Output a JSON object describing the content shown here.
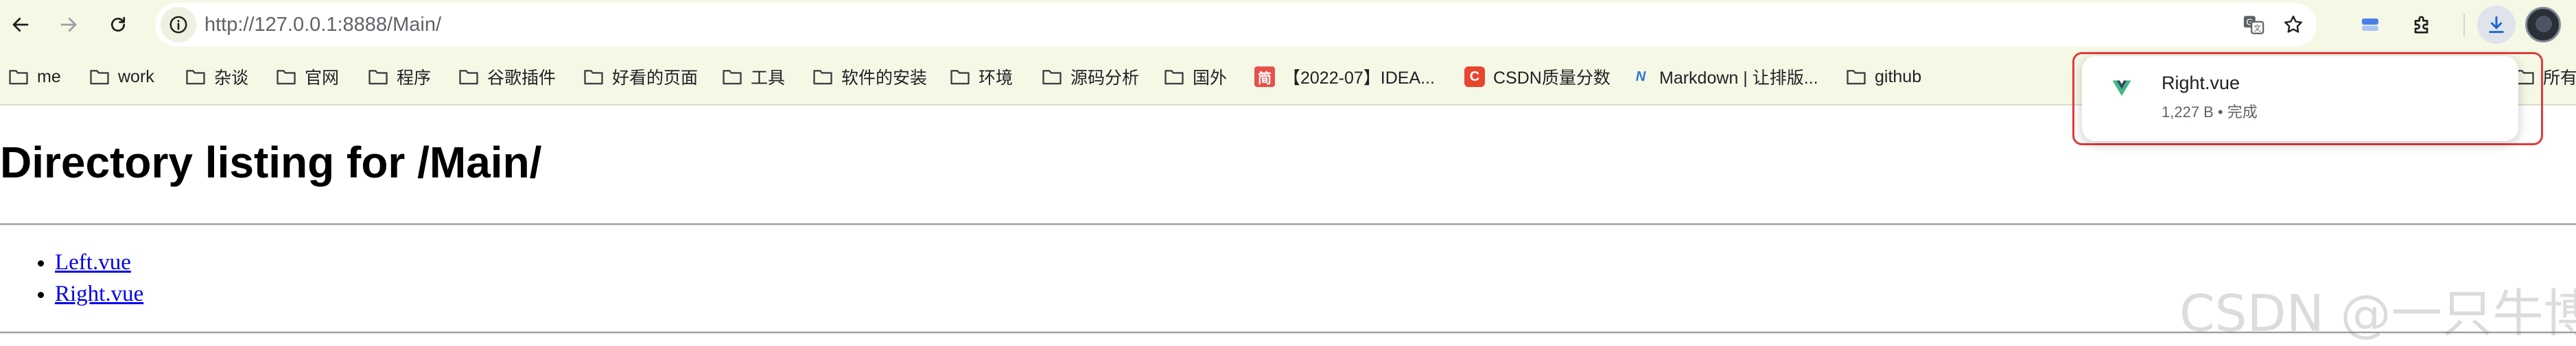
{
  "browser": {
    "url": "http://127.0.0.1:8888/Main/"
  },
  "bookmarks": [
    {
      "label": "me",
      "type": "folder"
    },
    {
      "label": "work",
      "type": "folder"
    },
    {
      "label": "杂谈",
      "type": "folder"
    },
    {
      "label": "官网",
      "type": "folder"
    },
    {
      "label": "程序",
      "type": "folder"
    },
    {
      "label": "谷歌插件",
      "type": "folder"
    },
    {
      "label": "好看的页面",
      "type": "folder"
    },
    {
      "label": "工具",
      "type": "folder"
    },
    {
      "label": "软件的安装",
      "type": "folder"
    },
    {
      "label": "环境",
      "type": "folder"
    },
    {
      "label": "源码分析",
      "type": "folder"
    },
    {
      "label": "国外",
      "type": "folder"
    },
    {
      "label": "【2022-07】IDEA...",
      "type": "site",
      "favicon_text": "简",
      "favicon_color": "#e8504a"
    },
    {
      "label": "CSDN质量分数",
      "type": "site",
      "favicon_text": "C",
      "favicon_color": "#e8452f"
    },
    {
      "label": "Markdown | 让排版...",
      "type": "site",
      "favicon_text": "N",
      "favicon_color": "#2f6fe0"
    },
    {
      "label": "github",
      "type": "folder"
    },
    {
      "label": "所有书",
      "type": "folder"
    }
  ],
  "page": {
    "title": "Directory listing for /Main/",
    "files": [
      "Left.vue",
      "Right.vue"
    ]
  },
  "download": {
    "filename": "Right.vue",
    "status": "1,227 B • 完成"
  },
  "watermark": "CSDN @一只牛博",
  "colors": {
    "toolbar_bg": "#f6f8e6",
    "link": "#0000ee",
    "highlight_outline": "#e23b3b"
  }
}
